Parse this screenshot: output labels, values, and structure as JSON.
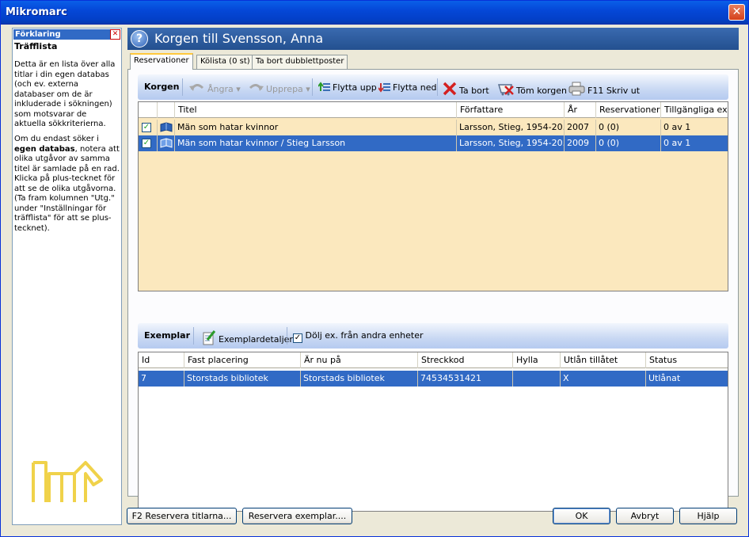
{
  "window": {
    "title": "Mikromarc",
    "close_label": "✕"
  },
  "help": {
    "header": "Förklaring",
    "close_label": "✕",
    "subtitle": "Träfflista",
    "paragraph1": "Detta är en lista över alla titlar i din egen databas (och ev. externa databaser om de är inkluderade i sökningen) som motsvarar de aktuella sökkriterierna.",
    "paragraph2_pre": "Om du endast söker i ",
    "paragraph2_bold": "egen databas",
    "paragraph2_post": ", notera att olika utgåvor av samma titel är samlade på en rad. Klicka på plus-tecknet för att se de olika utgåvorna. (Ta fram kolumnen \"Utg.\" under \"Inställningar för träfflista\" för att se plus-tecknet)."
  },
  "header": {
    "title": "Korgen till Svensson, Anna",
    "help_icon_label": "?"
  },
  "tabs": [
    {
      "label": "Reservationer",
      "active": true
    },
    {
      "label": "Kölista (0 st)",
      "active": false
    },
    {
      "label": "Ta bort dubblettposter",
      "active": false
    }
  ],
  "basket_toolbar": {
    "label": "Korgen",
    "undo": "Ångra",
    "redo": "Upprepa",
    "move_up": "Flytta upp",
    "move_down": "Flytta ned",
    "delete": "Ta bort",
    "empty": "Töm korgen",
    "print": "F11 Skriv ut"
  },
  "basket_table": {
    "columns": [
      "Titel",
      "Författare",
      "År",
      "Reservationer",
      "Tillgängliga ex."
    ],
    "rows": [
      {
        "title": "Män som hatar kvinnor",
        "author": "Larsson, Stieg, 1954-20...",
        "year": "2007",
        "reservations": "0 (0)",
        "available": "0 av 1",
        "checked": true,
        "selected": false
      },
      {
        "title": "Män som hatar kvinnor / Stieg Larsson",
        "author": "Larsson, Stieg, 1954-20...",
        "year": "2009",
        "reservations": "0 (0)",
        "available": "0 av 1",
        "checked": true,
        "selected": true
      }
    ]
  },
  "copies_toolbar": {
    "label": "Exemplar",
    "details": "Exemplardetaljer",
    "hide_other_units": "Dölj ex. från andra enheter",
    "hide_checked": true
  },
  "copies_table": {
    "columns": [
      "Id",
      "Fast placering",
      "Är nu på",
      "Streckkod",
      "Hylla",
      "Utlån tillåtet",
      "Status"
    ],
    "rows": [
      {
        "id": "7",
        "fixed_location": "Storstads bibliotek",
        "current_location": "Storstads bibliotek",
        "barcode": "74534531421",
        "shelf": "",
        "loan_allowed": "X",
        "status": "Utlånat"
      }
    ]
  },
  "buttons": {
    "reserve_titles": "F2 Reservera titlarna...",
    "reserve_copies": "Reservera exemplar....",
    "ok": "OK",
    "cancel": "Avbryt",
    "help": "Hjälp"
  },
  "colors": {
    "selection": "#316ac5",
    "row_bg": "#fbe8be",
    "header_blue": "#23508f"
  }
}
